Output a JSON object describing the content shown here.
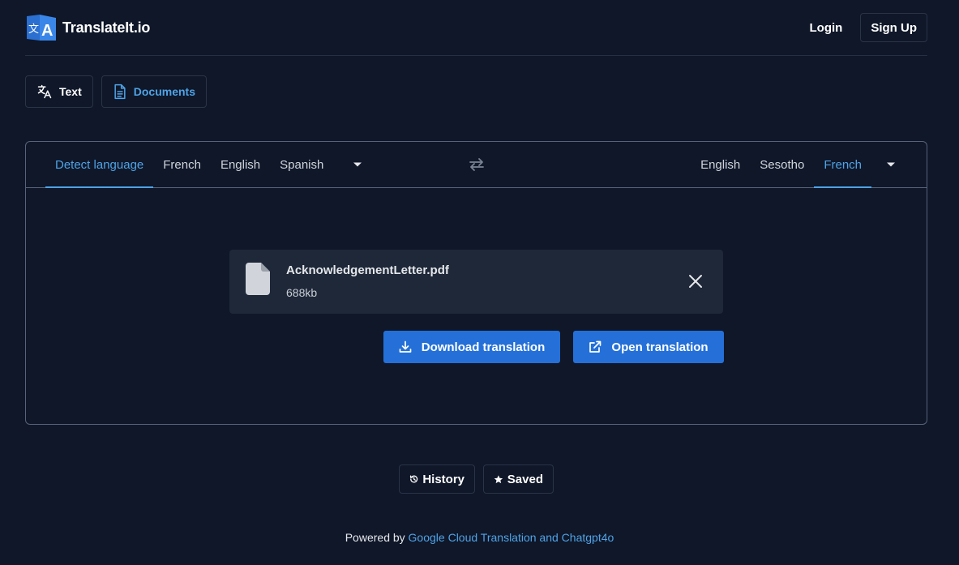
{
  "header": {
    "brand_name": "TranslateIt.io",
    "logo_letters": {
      "small": "文",
      "large": "A"
    },
    "login_label": "Login",
    "signup_label": "Sign Up"
  },
  "mode_tabs": [
    {
      "label": "Text",
      "icon": "translate-icon",
      "active": false
    },
    {
      "label": "Documents",
      "icon": "document-icon",
      "active": true
    }
  ],
  "source_languages": {
    "items": [
      {
        "label": "Detect language",
        "active": true
      },
      {
        "label": "French",
        "active": false
      },
      {
        "label": "English",
        "active": false
      },
      {
        "label": "Spanish",
        "active": false
      }
    ],
    "dropdown_icon": "caret-down-icon"
  },
  "swap_icon": "swap-arrows-icon",
  "target_languages": {
    "items": [
      {
        "label": "English",
        "active": false
      },
      {
        "label": "Sesotho",
        "active": false
      },
      {
        "label": "French",
        "active": true
      }
    ],
    "dropdown_icon": "caret-down-icon"
  },
  "file": {
    "name": "AcknowledgementLetter.pdf",
    "size": "688kb",
    "icon": "file-icon",
    "remove_icon": "close-icon"
  },
  "actions": {
    "download_label": "Download translation",
    "open_label": "Open translation"
  },
  "bottom_actions": {
    "history_label": "History",
    "saved_label": "Saved"
  },
  "footer": {
    "prefix": "Powered by ",
    "link_text": "Google Cloud Translation and Chatgpt4o"
  },
  "colors": {
    "background": "#0f1729",
    "accent": "#4fa3e6",
    "primary_button": "#2470d8",
    "card": "#1e2838",
    "border": "#56637a"
  }
}
